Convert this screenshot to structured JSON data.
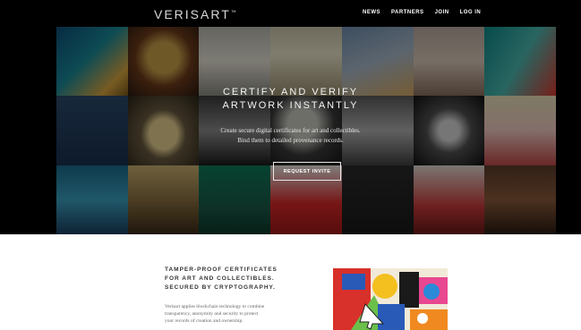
{
  "nav": {
    "logo": "VERISART",
    "logo_mark": "™",
    "links": [
      "NEWS",
      "PARTNERS",
      "JOIN",
      "LOG IN"
    ]
  },
  "hero": {
    "title_line1": "CERTIFY AND VERIFY",
    "title_line2": "ARTWORK INSTANTLY",
    "subtitle_line1": "Create secure digital certificates for art and collectibles.",
    "subtitle_line2": "Bind them to detailed provenance records.",
    "cta_label": "REQUEST INVITE"
  },
  "section": {
    "title_line1": "TAMPER-PROOF CERTIFICATES",
    "title_line2": "FOR ART AND COLLECTIBLES.",
    "title_line3": "SECURED BY CRYPTOGRAPHY.",
    "body_line1": "Verisart applies blockchain technology to combine",
    "body_line2": "transparency, anonymity and security to protect",
    "body_line3": "your records of creation and ownership."
  },
  "colors": {
    "hero_bg": "#000000",
    "page_bg": "#ffffff",
    "accent_text": "#ffffff"
  }
}
